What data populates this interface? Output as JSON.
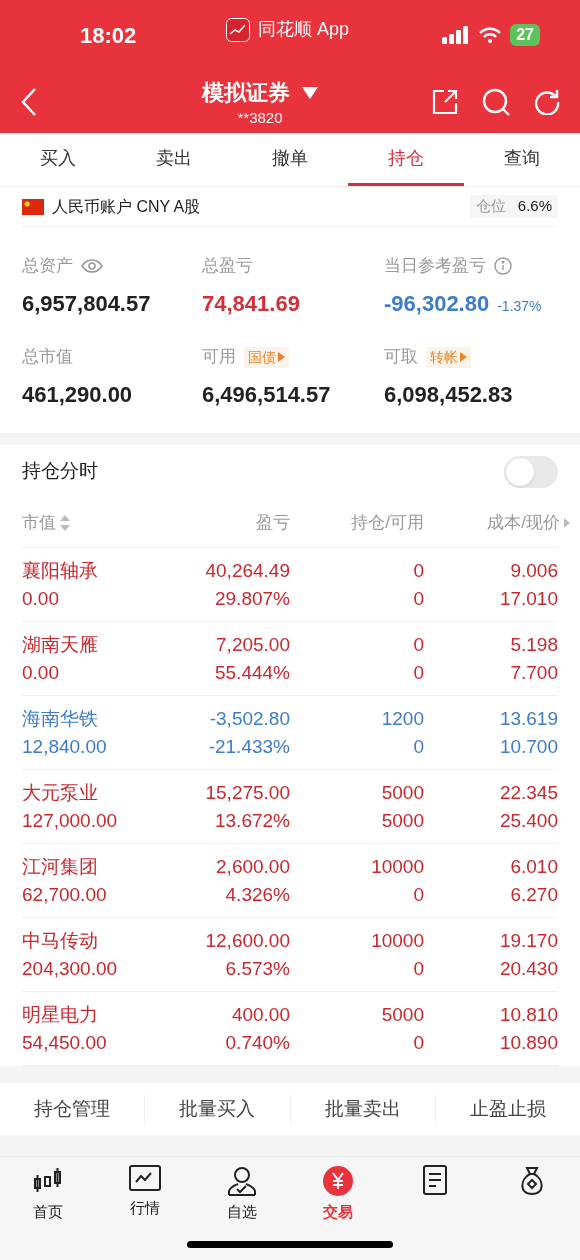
{
  "status_bar": {
    "time": "18:02",
    "app": "同花顺 App",
    "battery": "27"
  },
  "header": {
    "title": "模拟证券",
    "account": "**3820"
  },
  "tabs": [
    {
      "label": "买入",
      "selected": false
    },
    {
      "label": "卖出",
      "selected": false
    },
    {
      "label": "撤单",
      "selected": false
    },
    {
      "label": "持仓",
      "selected": true
    },
    {
      "label": "查询",
      "selected": false
    }
  ],
  "account_bar": {
    "label": "人民币账户 CNY A股",
    "position_label": "仓位",
    "position_value": "6.6%"
  },
  "summary": [
    {
      "label": "总资产",
      "value": "6,957,804.57",
      "kind": "eye",
      "color": "#222222"
    },
    {
      "label": "总盈亏",
      "value": "74,841.69",
      "kind": "plain",
      "color": "#d0303a"
    },
    {
      "label": "当日参考盈亏",
      "value": "-96,302.80",
      "change": "-1.37%",
      "kind": "info",
      "color": "#3d7cc9"
    },
    {
      "label": "总市值",
      "value": "461,290.00",
      "kind": "plain",
      "color": "#222222"
    },
    {
      "label": "可用",
      "value": "6,496,514.57",
      "kind": "link",
      "link": "国债",
      "color": "#222222"
    },
    {
      "label": "可取",
      "value": "6,098,452.83",
      "kind": "link",
      "link": "转帐",
      "color": "#222222"
    }
  ],
  "intraday_toggle": {
    "label": "持仓分时",
    "on": false
  },
  "table": {
    "columns": [
      "市值",
      "盈亏",
      "持仓/可用",
      "成本/现价"
    ],
    "rows": [
      {
        "name": "襄阳轴承",
        "market_value": "0.00",
        "pnl": "40,264.49",
        "pnl_pct": "29.807%",
        "holding": "0",
        "available": "0",
        "cost": "9.006",
        "price": "17.010",
        "loss": false
      },
      {
        "name": "湖南天雁",
        "market_value": "0.00",
        "pnl": "7,205.00",
        "pnl_pct": "55.444%",
        "holding": "0",
        "available": "0",
        "cost": "5.198",
        "price": "7.700",
        "loss": false
      },
      {
        "name": "海南华铁",
        "market_value": "12,840.00",
        "pnl": "-3,502.80",
        "pnl_pct": "-21.433%",
        "holding": "1200",
        "available": "0",
        "cost": "13.619",
        "price": "10.700",
        "loss": true
      },
      {
        "name": "大元泵业",
        "market_value": "127,000.00",
        "pnl": "15,275.00",
        "pnl_pct": "13.672%",
        "holding": "5000",
        "available": "5000",
        "cost": "22.345",
        "price": "25.400",
        "loss": false
      },
      {
        "name": "江河集团",
        "market_value": "62,700.00",
        "pnl": "2,600.00",
        "pnl_pct": "4.326%",
        "holding": "10000",
        "available": "0",
        "cost": "6.010",
        "price": "6.270",
        "loss": false
      },
      {
        "name": "中马传动",
        "market_value": "204,300.00",
        "pnl": "12,600.00",
        "pnl_pct": "6.573%",
        "holding": "10000",
        "available": "0",
        "cost": "19.170",
        "price": "20.430",
        "loss": false
      },
      {
        "name": "明星电力",
        "market_value": "54,450.00",
        "pnl": "400.00",
        "pnl_pct": "0.740%",
        "holding": "5000",
        "available": "0",
        "cost": "10.810",
        "price": "10.890",
        "loss": false
      }
    ]
  },
  "actions": [
    "持仓管理",
    "批量买入",
    "批量卖出",
    "止盈止损"
  ],
  "bottom_nav": [
    {
      "label": "首页",
      "kind": "candles",
      "selected": false
    },
    {
      "label": "行情",
      "kind": "chart",
      "selected": false
    },
    {
      "label": "自选",
      "kind": "person",
      "selected": false
    },
    {
      "label": "交易",
      "kind": "trade",
      "selected": true
    },
    {
      "kind": "document",
      "selected": false
    },
    {
      "kind": "bag",
      "selected": false
    }
  ]
}
